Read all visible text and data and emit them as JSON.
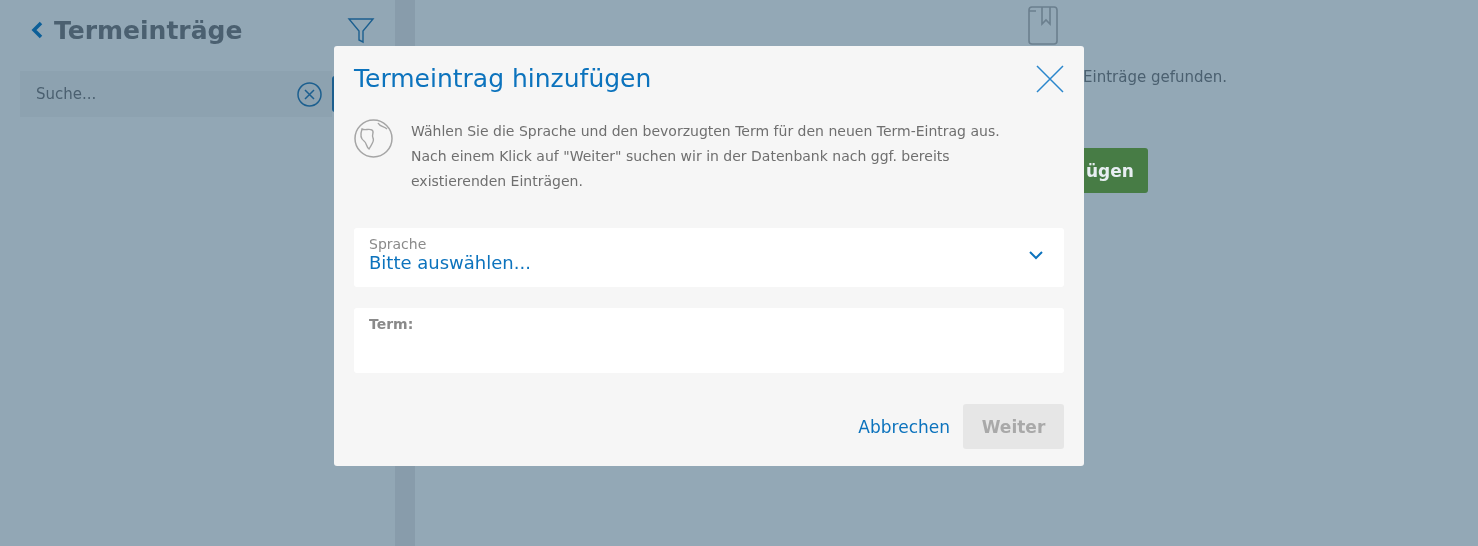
{
  "sidebar": {
    "title": "Termeinträge",
    "search": {
      "placeholder": "Suche..."
    }
  },
  "main": {
    "message": "Einträge gefunden.",
    "add_button": "ügen"
  },
  "dialog": {
    "title": "Termeintrag hinzufügen",
    "description": "Wählen Sie die Sprache und den bevorzugten Term für den neuen Term-Eintrag aus. Nach einem Klick auf \"Weiter\" suchen wir in der Datenbank nach ggf. bereits existierenden Einträgen.",
    "fields": [
      {
        "kind": "select",
        "label": "Sprache",
        "value": "Bitte auswählen..."
      },
      {
        "kind": "text",
        "label": "Term:"
      }
    ],
    "buttons": [
      {
        "kind": "link",
        "label": "Abbrechen",
        "disabled": false
      },
      {
        "kind": "primary",
        "label": "Weiter",
        "disabled": true
      }
    ]
  }
}
